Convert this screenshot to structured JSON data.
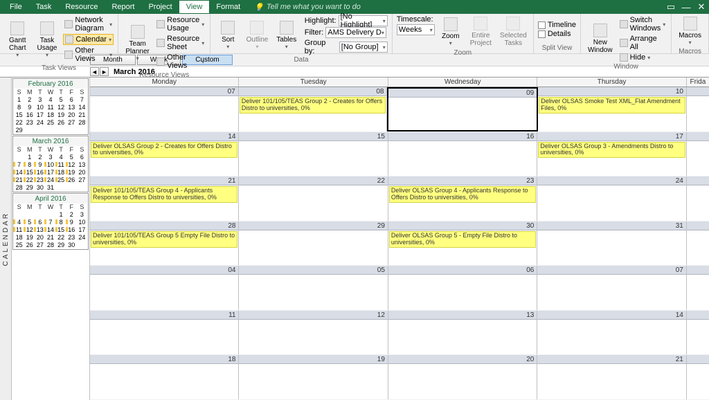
{
  "tabs": [
    "File",
    "Task",
    "Resource",
    "Report",
    "Project",
    "View",
    "Format"
  ],
  "active_tab": "View",
  "tell_me": "Tell me what you want to do",
  "ribbon": {
    "task_views": {
      "label": "Task Views",
      "gantt": "Gantt\nChart",
      "task": "Task\nUsage",
      "network": "Network Diagram",
      "calendar": "Calendar",
      "other": "Other Views"
    },
    "resource_views": {
      "label": "Resource Views",
      "team": "Team\nPlanner",
      "usage": "Resource Usage",
      "sheet": "Resource Sheet",
      "other": "Other Views"
    },
    "data": {
      "label": "Data",
      "sort": "Sort",
      "outline": "Outline",
      "tables": "Tables",
      "highlight_label": "Highlight:",
      "highlight_val": "[No Highlight]",
      "filter_label": "Filter:",
      "filter_val": "AMS Delivery D",
      "group_label": "Group by:",
      "group_val": "[No Group]"
    },
    "zoom": {
      "label": "Zoom",
      "timescale": "Timescale:",
      "timescale_val": "Weeks",
      "zoom": "Zoom",
      "entire": "Entire\nProject",
      "selected": "Selected\nTasks"
    },
    "split": {
      "label": "Split View",
      "timeline": "Timeline",
      "details": "Details"
    },
    "window": {
      "label": "Window",
      "new": "New\nWindow",
      "switch": "Switch Windows",
      "arrange": "Arrange All",
      "hide": "Hide"
    },
    "macros": {
      "label": "Macros",
      "macros": "Macros"
    }
  },
  "subnav": {
    "month": "Month",
    "week": "Week",
    "custom": "Custom"
  },
  "current_period": "March 2016",
  "mini_cals": [
    {
      "title": "February 2016",
      "offset": 0,
      "days": 29,
      "marked": []
    },
    {
      "title": "March 2016",
      "offset": 1,
      "days": 31,
      "marked": [
        7,
        8,
        9,
        10,
        11,
        12,
        14,
        15,
        16,
        17,
        18,
        19,
        21,
        22,
        23,
        24,
        25,
        26
      ]
    },
    {
      "title": "April 2016",
      "offset": 4,
      "days": 30,
      "marked": [
        4,
        5,
        6,
        7,
        8,
        9,
        11,
        12,
        13,
        14,
        15,
        16
      ]
    }
  ],
  "day_headers": [
    "Monday",
    "Tuesday",
    "Wednesday",
    "Thursday",
    "Frida"
  ],
  "weeks": [
    {
      "dates": [
        "07",
        "08",
        "09",
        "10",
        ""
      ],
      "selected": 2,
      "tasks": [
        {
          "col": 1,
          "text": "Deliver 101/105/TEAS Group 2 - Creates for Offers Distro to universities, 0%"
        },
        {
          "col": 3,
          "text": "Deliver OLSAS Smoke Test XML_Flat Amendment Files, 0%"
        }
      ]
    },
    {
      "dates": [
        "14",
        "15",
        "16",
        "17",
        ""
      ],
      "tasks": [
        {
          "col": 0,
          "text": "Deliver OLSAS Group 2 - Creates for Offers Distro to universities, 0%"
        },
        {
          "col": 3,
          "text": "Deliver OLSAS Group 3 - Amendments Distro to universities, 0%"
        }
      ]
    },
    {
      "dates": [
        "21",
        "22",
        "23",
        "24",
        ""
      ],
      "tasks": [
        {
          "col": 0,
          "text": "Deliver 101/105/TEAS Group 4 - Applicants Response to Offers Distro to universities, 0%"
        },
        {
          "col": 2,
          "text": "Deliver OLSAS Group 4 - Applicants Response to Offers Distro to universities, 0%"
        }
      ]
    },
    {
      "dates": [
        "28",
        "29",
        "30",
        "31",
        ""
      ],
      "tasks": [
        {
          "col": 0,
          "text": "Deliver 101/105/TEAS Group 5 Empty File Distro to universities, 0%"
        },
        {
          "col": 2,
          "text": "Deliver OLSAS Group 5 - Empty File Distro to universities, 0%"
        }
      ]
    },
    {
      "dates": [
        "04",
        "05",
        "06",
        "07",
        ""
      ],
      "tasks": []
    },
    {
      "dates": [
        "11",
        "12",
        "13",
        "14",
        ""
      ],
      "tasks": []
    },
    {
      "dates": [
        "18",
        "19",
        "20",
        "21",
        ""
      ],
      "tasks": []
    }
  ]
}
